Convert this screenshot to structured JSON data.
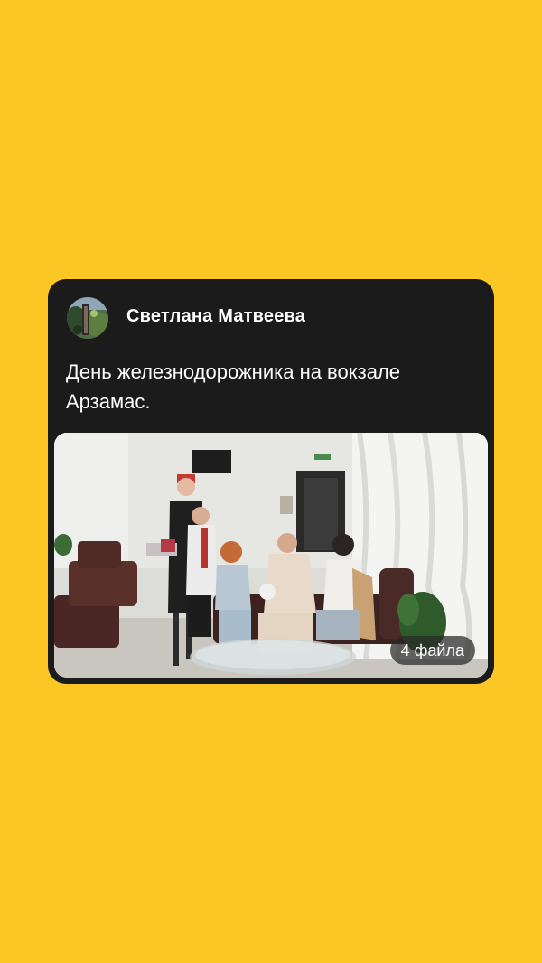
{
  "post": {
    "author_name": "Светлана Матвеева",
    "avatar_icon": "author-avatar-photo",
    "text": "День железнодорожника на вокзале Арзамас.",
    "media": {
      "icon": "group-photo-thumbnail",
      "files_badge": "4 файла"
    }
  },
  "colors": {
    "background": "#FCC624",
    "card": "#1B1B1C",
    "text": "#FFFFFF"
  }
}
